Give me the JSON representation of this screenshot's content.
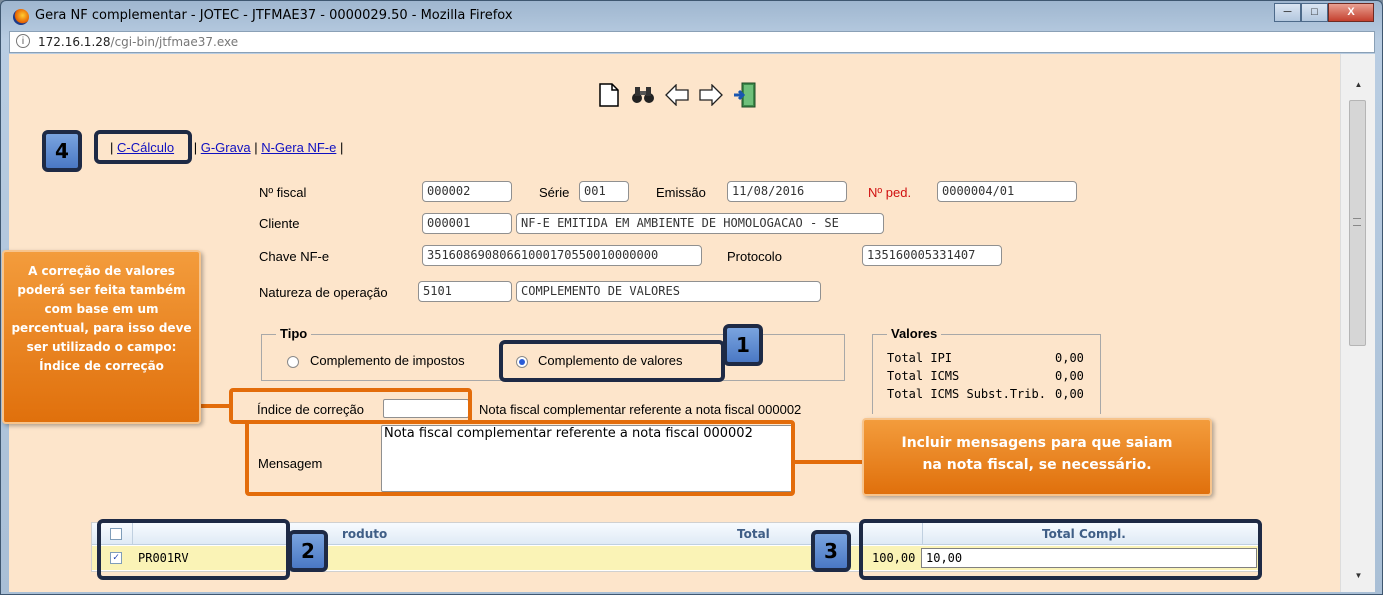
{
  "window": {
    "title": "Gera NF complementar - JOTEC - JTFMAE37 - 0000029.50 - Mozilla Firefox",
    "minimize": "─",
    "maximize": "□",
    "close": "X"
  },
  "browser": {
    "url_host": "172.16.1.28",
    "url_path": "/cgi-bin/jtfmae37.exe"
  },
  "toolbar": [
    "new-document-icon",
    "binoculars-icon",
    "arrow-left-icon",
    "arrow-right-icon",
    "exit-icon"
  ],
  "menu": {
    "sep": "|",
    "calc": "C-Cálculo",
    "save": "G-Grava",
    "gen": "N-Gera NF-e"
  },
  "form": {
    "nfiscal_label": "Nº fiscal",
    "nfiscal": "000002",
    "serie_label": "Série",
    "serie": "001",
    "emissao_label": "Emissão",
    "emissao": "11/08/2016",
    "nped_label": "Nº ped.",
    "nped": "0000004/01",
    "cliente_label": "Cliente",
    "cliente_code": "000001",
    "cliente_name": "NF-E EMITIDA EM AMBIENTE DE HOMOLOGACAO - SE",
    "chave_label": "Chave NF-e",
    "chave": "35160869080661000170550010000000",
    "protocolo_label": "Protocolo",
    "protocolo": "135160005331407",
    "natureza_label": "Natureza de operação",
    "natureza_code": "5101",
    "natureza_desc": "COMPLEMENTO DE VALORES",
    "indice_label": "Índice de correção",
    "indice": "",
    "nota_text": "Nota fiscal complementar referente a nota fiscal 000002",
    "mensagem_label": "Mensagem",
    "mensagem": "Nota fiscal complementar referente a nota fiscal 000002"
  },
  "tipo": {
    "legend": "Tipo",
    "opt1": "Complemento de impostos",
    "opt2": "Complemento de valores",
    "selected": "Complemento de valores"
  },
  "valores": {
    "legend": "Valores",
    "ipi_label": "Total IPI",
    "ipi": "0,00",
    "icms_label": "Total ICMS",
    "icms": "0,00",
    "st_label": "Total ICMS Subst.Trib.",
    "st": "0,00"
  },
  "grid": {
    "headers": {
      "produto": "roduto",
      "total": "Total",
      "compl": "Total Compl."
    },
    "row": {
      "produto": "PR001RV",
      "total": "100,00",
      "compl": "10,00",
      "checked": true
    }
  },
  "annotations": {
    "b1": "1",
    "b2": "2",
    "b3": "3",
    "b4": "4",
    "note_left": "A correção de valores poderá ser feita também com base em um percentual, para isso deve ser utilizado o campo: Índice de correção",
    "note_right": "Incluir mensagens para que saiam na nota fiscal, se necessário."
  },
  "colors": {
    "page_bg": "#fde5cb",
    "annot_orange": "#e36c0a",
    "annot_blue": "#4a78c4",
    "annot_border": "#1e2a45"
  }
}
